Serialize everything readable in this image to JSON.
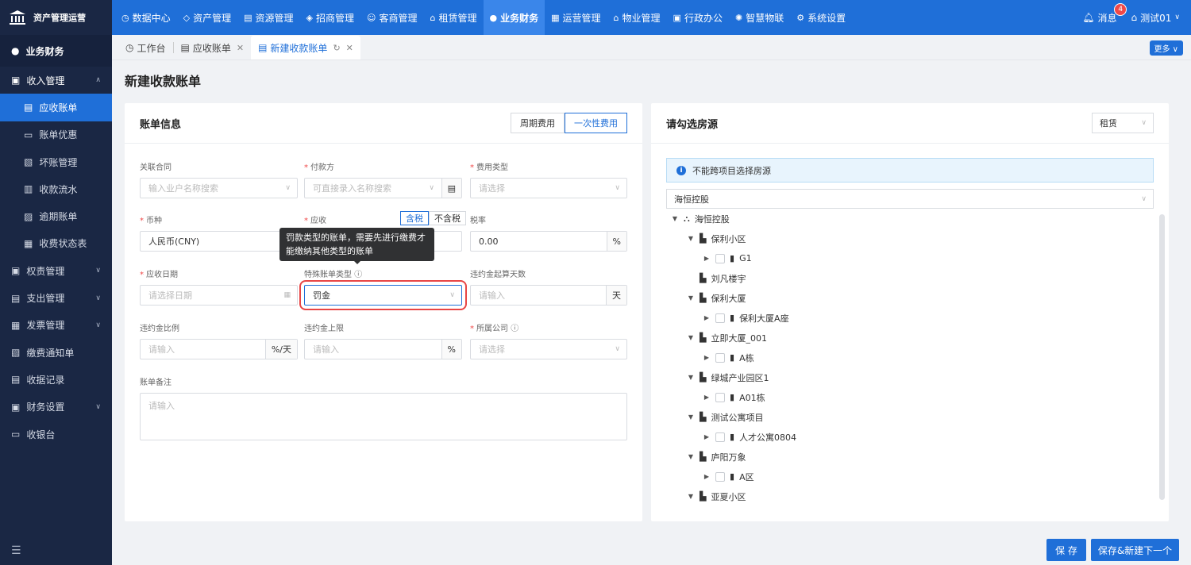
{
  "app": {
    "title": "资产管理运营"
  },
  "nav": {
    "items": [
      {
        "label": "数据中心",
        "icon": "dashboard-icon"
      },
      {
        "label": "资产管理",
        "icon": "cube-icon"
      },
      {
        "label": "资源管理",
        "icon": "resource-icon"
      },
      {
        "label": "招商管理",
        "icon": "tag-icon"
      },
      {
        "label": "客商管理",
        "icon": "people-icon"
      },
      {
        "label": "租赁管理",
        "icon": "house-icon"
      },
      {
        "label": "业务财务",
        "icon": "finance-icon"
      },
      {
        "label": "运营管理",
        "icon": "chart-icon"
      },
      {
        "label": "物业管理",
        "icon": "home-icon"
      },
      {
        "label": "行政办公",
        "icon": "monitor-icon"
      },
      {
        "label": "智慧物联",
        "icon": "iot-icon"
      },
      {
        "label": "系统设置",
        "icon": "gear-icon"
      }
    ],
    "message_label": "消息",
    "message_count": "4",
    "user_name": "测试01"
  },
  "sidebar": {
    "header": "业务财务",
    "items": [
      {
        "label": "收入管理"
      },
      {
        "label": "应收账单"
      },
      {
        "label": "账单优惠"
      },
      {
        "label": "坏账管理"
      },
      {
        "label": "收款流水"
      },
      {
        "label": "逾期账单"
      },
      {
        "label": "收费状态表"
      },
      {
        "label": "权责管理"
      },
      {
        "label": "支出管理"
      },
      {
        "label": "发票管理"
      },
      {
        "label": "缴费通知单"
      },
      {
        "label": "收据记录"
      },
      {
        "label": "财务设置"
      },
      {
        "label": "收银台"
      }
    ]
  },
  "tabs": {
    "items": [
      {
        "label": "工作台"
      },
      {
        "label": "应收账单"
      },
      {
        "label": "新建收款账单"
      }
    ],
    "more_label": "更多"
  },
  "page": {
    "title": "新建收款账单"
  },
  "bill": {
    "title": "账单信息",
    "fee_modes": [
      "周期费用",
      "一次性费用"
    ],
    "contract": {
      "label": "关联合同",
      "placeholder": "输入业户名称搜索"
    },
    "payer": {
      "label": "付款方",
      "placeholder": "可直接录入名称搜索"
    },
    "fee_type": {
      "label": "费用类型",
      "placeholder": "请选择"
    },
    "currency": {
      "label": "币种",
      "value": "人民币(CNY)"
    },
    "receivable": {
      "label": "应收",
      "tax_options": [
        "含税",
        "不含税"
      ]
    },
    "tax_rate": {
      "label": "税率",
      "value": "0.00",
      "unit": "%"
    },
    "due_date": {
      "label": "应收日期",
      "placeholder": "请选择日期"
    },
    "special_type": {
      "label": "特殊账单类型",
      "value": "罚金"
    },
    "penalty_days": {
      "label": "违约金起算天数",
      "placeholder": "请输入",
      "unit": "天"
    },
    "penalty_rate": {
      "label": "违约金比例",
      "placeholder": "请输入",
      "unit": "%/天"
    },
    "penalty_cap": {
      "label": "违约金上限",
      "placeholder": "请输入",
      "unit": "%"
    },
    "company": {
      "label": "所属公司",
      "placeholder": "请选择"
    },
    "remark": {
      "label": "账单备注",
      "placeholder": "请输入"
    },
    "tooltip": "罚款类型的账单，需要先进行缴费才能缴纳其他类型的账单"
  },
  "rooms": {
    "title": "请勾选房源",
    "rent_type": "租赁",
    "notice": "不能跨项目选择房源",
    "project": "海恒控股",
    "tree": [
      {
        "label": "海恒控股",
        "level": 0,
        "arrow": "down",
        "checkbox": false,
        "icon": "org-icon"
      },
      {
        "label": "保利小区",
        "level": 1,
        "arrow": "down",
        "checkbox": false,
        "icon": "building-icon"
      },
      {
        "label": "G1",
        "level": 2,
        "arrow": "right",
        "checkbox": true,
        "icon": "block-icon"
      },
      {
        "label": "刘凡楼宇",
        "level": 1,
        "arrow": "none",
        "checkbox": false,
        "icon": "building-icon"
      },
      {
        "label": "保利大厦",
        "level": 1,
        "arrow": "down",
        "checkbox": false,
        "icon": "building-icon"
      },
      {
        "label": "保利大厦A座",
        "level": 2,
        "arrow": "right",
        "checkbox": true,
        "icon": "block-icon"
      },
      {
        "label": "立即大厦_001",
        "level": 1,
        "arrow": "down",
        "checkbox": false,
        "icon": "building-icon"
      },
      {
        "label": "A栋",
        "level": 2,
        "arrow": "right",
        "checkbox": true,
        "icon": "block-icon"
      },
      {
        "label": "绿城产业园区1",
        "level": 1,
        "arrow": "down",
        "checkbox": false,
        "icon": "building-icon"
      },
      {
        "label": "A01栋",
        "level": 2,
        "arrow": "right",
        "checkbox": true,
        "icon": "block-icon"
      },
      {
        "label": "测试公寓项目",
        "level": 1,
        "arrow": "down",
        "checkbox": false,
        "icon": "building-icon"
      },
      {
        "label": "人才公寓0804",
        "level": 2,
        "arrow": "right",
        "checkbox": true,
        "icon": "block-icon"
      },
      {
        "label": "庐阳万象",
        "level": 1,
        "arrow": "down",
        "checkbox": false,
        "icon": "building-icon"
      },
      {
        "label": "A区",
        "level": 2,
        "arrow": "right",
        "checkbox": true,
        "icon": "block-icon"
      },
      {
        "label": "亚夏小区",
        "level": 1,
        "arrow": "down",
        "checkbox": false,
        "icon": "building-icon"
      }
    ]
  },
  "actions": {
    "save": "保 存",
    "save_next": "保存&新建下一个"
  }
}
